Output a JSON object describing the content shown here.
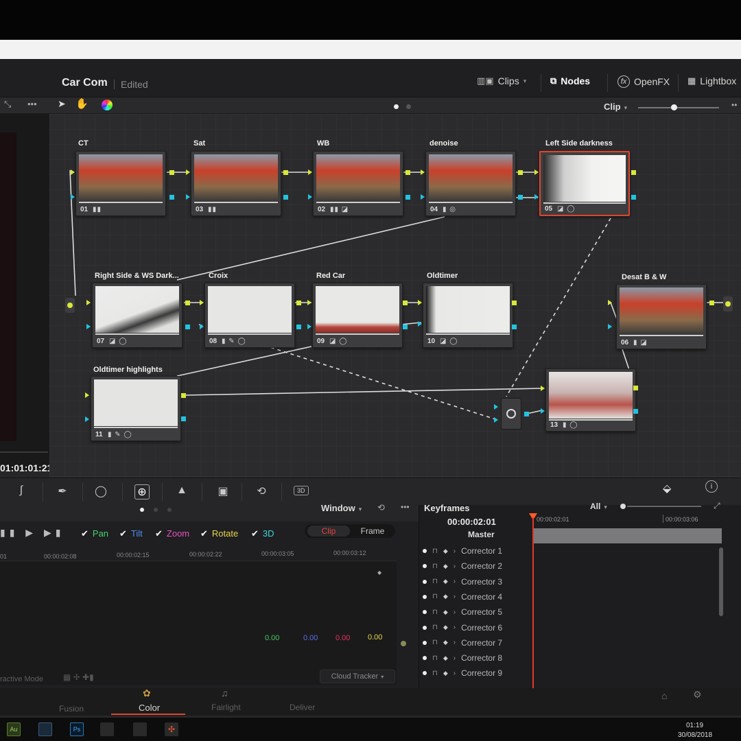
{
  "project": {
    "title": "Car Com",
    "status": "Edited"
  },
  "header_tabs": {
    "clips": "Clips",
    "nodes": "Nodes",
    "openfx": "OpenFX",
    "lightbox": "Lightbox"
  },
  "node_toolbar": {
    "mode": "Clip"
  },
  "timecode": "01:01:01:21",
  "nodes": [
    {
      "label": "CT",
      "num": "01"
    },
    {
      "label": "Sat",
      "num": "03"
    },
    {
      "label": "WB",
      "num": "02"
    },
    {
      "label": "denoise",
      "num": "04"
    },
    {
      "label": "Left Side darkness",
      "num": "05"
    },
    {
      "label": "Right Side & WS Dark...",
      "num": "07"
    },
    {
      "label": "Croix",
      "num": "08"
    },
    {
      "label": "Red Car",
      "num": "09"
    },
    {
      "label": "Oldtimer",
      "num": "10"
    },
    {
      "label": "Desat B & W",
      "num": "06"
    },
    {
      "label": "Oldtimer highlights",
      "num": "11"
    },
    {
      "label": "",
      "num": "13"
    }
  ],
  "window_panel": {
    "title": "Window",
    "checks": [
      "Pan",
      "Tilt",
      "Zoom",
      "Rotate",
      "3D"
    ],
    "check_colors": [
      "#46d16a",
      "#4b8ef0",
      "#e84fc2",
      "#e8d44a",
      "#3fd6d6"
    ],
    "clip_tab": "Clip",
    "frame_tab": "Frame",
    "ruler": [
      "01",
      "00:00:02:08",
      "00:00:02:15",
      "00:00:02:22",
      "00:00:03:05",
      "00:00:03:12"
    ],
    "values": [
      "0.00",
      "0.00",
      "0.00",
      "0.00"
    ],
    "value_colors": [
      "#45c95e",
      "#5a6fe0",
      "#e8325a",
      "#e8d44a"
    ],
    "mode_label": "ractive Mode",
    "tracker": "Cloud Tracker"
  },
  "keyframes": {
    "title": "Keyframes",
    "filter": "All",
    "current_tc": "00:00:02:01",
    "ruler_start": "00:00:02:01",
    "ruler_end": "00:00:03:06",
    "master": "Master",
    "correctors": [
      "Corrector 1",
      "Corrector 2",
      "Corrector 3",
      "Corrector 4",
      "Corrector 5",
      "Corrector 6",
      "Corrector 7",
      "Corrector 8",
      "Corrector 9"
    ]
  },
  "pages": [
    "Fusion",
    "Color",
    "Fairlight",
    "Deliver"
  ],
  "active_page": "Color",
  "clock": {
    "time": "01:19",
    "date": "30/08/2018"
  },
  "accent": "#e0452b"
}
